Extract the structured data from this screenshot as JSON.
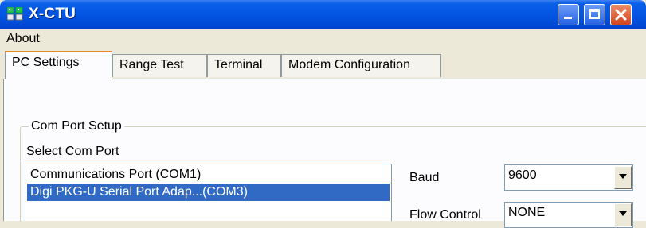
{
  "window": {
    "title": "X-CTU"
  },
  "menubar": {
    "items": [
      "About"
    ]
  },
  "tabs": [
    {
      "label": "PC Settings",
      "active": true
    },
    {
      "label": "Range Test",
      "active": false
    },
    {
      "label": "Terminal",
      "active": false
    },
    {
      "label": "Modem Configuration",
      "active": false
    }
  ],
  "com_port_setup": {
    "group_title": "Com Port Setup",
    "select_label": "Select Com Port",
    "ports": [
      {
        "label": "Communications Port (COM1)",
        "selected": false
      },
      {
        "label": "Digi PKG-U Serial Port Adap...(COM3)",
        "selected": true
      }
    ],
    "baud": {
      "label": "Baud",
      "value": "9600"
    },
    "flow_control": {
      "label": "Flow Control",
      "value": "NONE"
    }
  },
  "colors": {
    "titlebar": "#0355e2",
    "selection": "#316ac5",
    "active_tab_accent": "#e68b2c"
  }
}
